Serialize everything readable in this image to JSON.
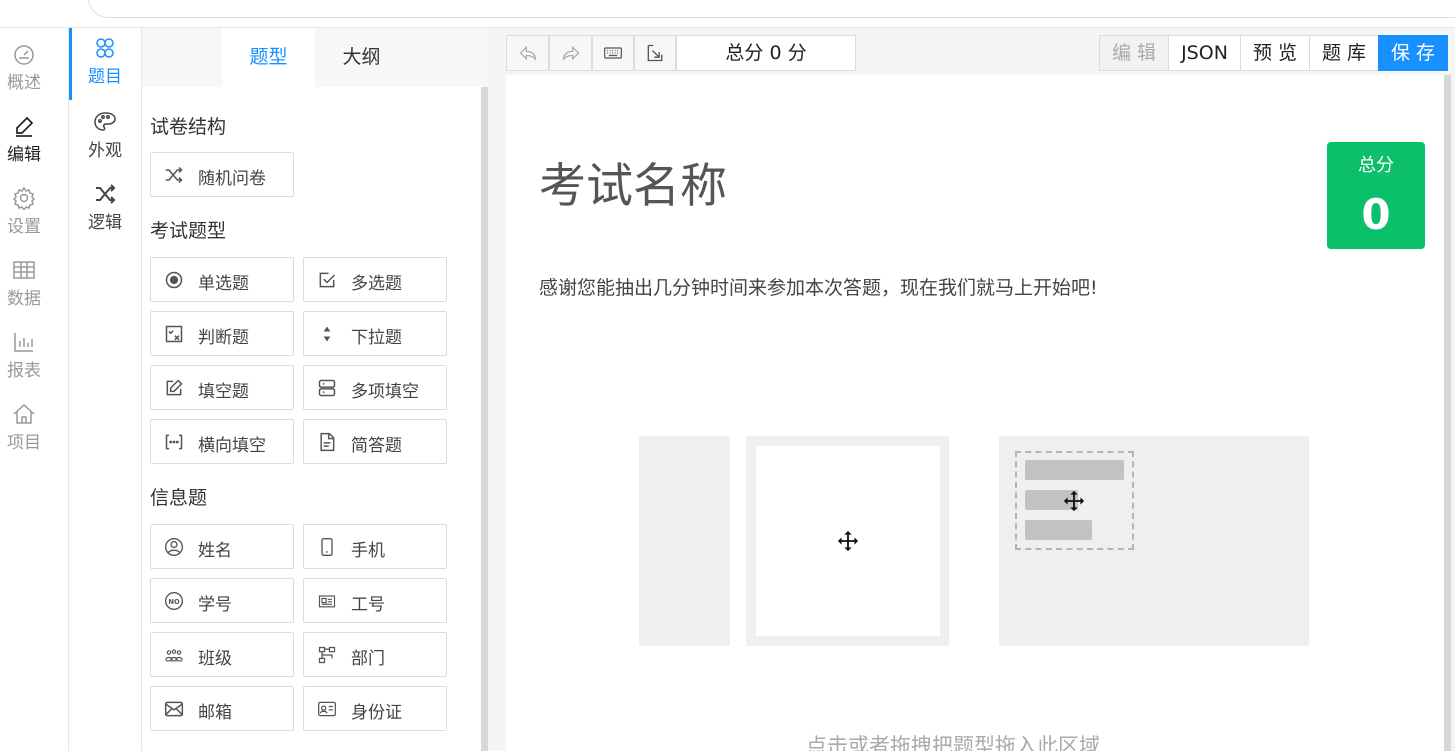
{
  "left_nav": [
    {
      "label": "概述",
      "icon": "dashboard-icon"
    },
    {
      "label": "编辑",
      "icon": "pen-icon"
    },
    {
      "label": "设置",
      "icon": "gear-icon"
    },
    {
      "label": "数据",
      "icon": "table-icon"
    },
    {
      "label": "报表",
      "icon": "bar-chart-icon"
    },
    {
      "label": "项目",
      "icon": "home-icon"
    }
  ],
  "sub_nav": [
    {
      "label": "题目",
      "icon": "clover-icon"
    },
    {
      "label": "外观",
      "icon": "palette-icon"
    },
    {
      "label": "逻辑",
      "icon": "shuffle-icon"
    }
  ],
  "panel": {
    "tabs": [
      "题型",
      "大纲"
    ],
    "sections": {
      "structure": "试卷结构",
      "exam_types": "考试题型",
      "info": "信息题"
    },
    "structure_items": [
      {
        "label": "随机问卷",
        "icon": "shuffle-icon"
      }
    ],
    "exam_items": [
      {
        "label": "单选题",
        "icon": "radio-icon"
      },
      {
        "label": "多选题",
        "icon": "checkbox-icon"
      },
      {
        "label": "判断题",
        "icon": "true-false-icon"
      },
      {
        "label": "下拉题",
        "icon": "dropdown-icon"
      },
      {
        "label": "填空题",
        "icon": "edit-icon"
      },
      {
        "label": "多项填空",
        "icon": "multi-fill-icon"
      },
      {
        "label": "横向填空",
        "icon": "inline-fill-icon"
      },
      {
        "label": "简答题",
        "icon": "document-icon"
      }
    ],
    "info_items": [
      {
        "label": "姓名",
        "icon": "user-icon"
      },
      {
        "label": "手机",
        "icon": "phone-icon"
      },
      {
        "label": "学号",
        "icon": "number-icon"
      },
      {
        "label": "工号",
        "icon": "id-badge-icon"
      },
      {
        "label": "班级",
        "icon": "class-icon"
      },
      {
        "label": "部门",
        "icon": "org-icon"
      },
      {
        "label": "邮箱",
        "icon": "mail-icon"
      },
      {
        "label": "身份证",
        "icon": "id-card-icon"
      }
    ]
  },
  "toolbar": {
    "score": "总分 0 分",
    "edit": "编 辑",
    "json": "JSON",
    "preview": "预 览",
    "bank": "题 库",
    "save": "保 存"
  },
  "exam": {
    "title": "考试名称",
    "description": "感谢您能抽出几分钟时间来参加本次答题，现在我们就马上开始吧!",
    "score_label": "总分",
    "score_value": "0",
    "drop_hint": "点击或者拖拽把题型拖入此区域"
  },
  "colors": {
    "accent": "#1890ff",
    "score_green": "#0cbf6b"
  }
}
